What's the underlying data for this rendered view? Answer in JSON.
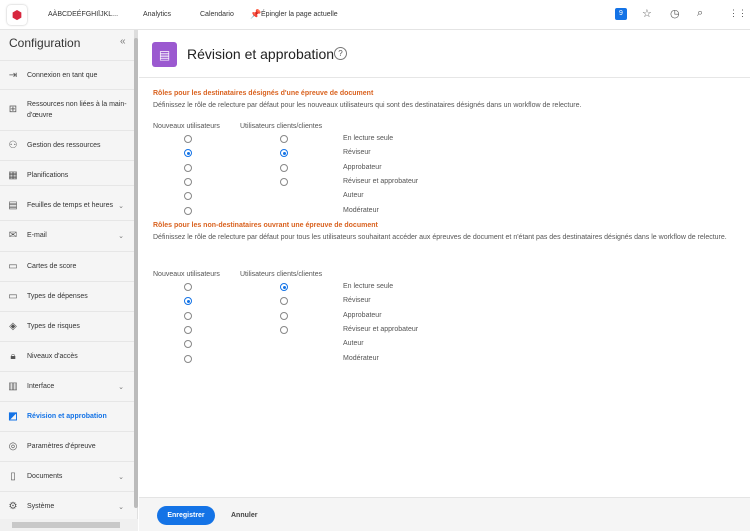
{
  "topbar": {
    "account": "AÀBCDEÉFGHIÏJKL...",
    "analytics": "Analytics",
    "calendar": "Calendario",
    "pin": "Épingler la page actuelle",
    "notif_count": "9"
  },
  "sidebar": {
    "title": "Configuration",
    "items": [
      {
        "label": "Connexion en tant que",
        "icon": "login-icon"
      },
      {
        "label": "Ressources non liées à la main-d'œuvre",
        "icon": "resources-icon"
      },
      {
        "label": "Gestion des ressources",
        "icon": "people-icon"
      },
      {
        "label": "Planifications",
        "icon": "calendar-icon"
      },
      {
        "label": "Feuilles de temps et heures",
        "icon": "timesheet-icon",
        "chevron": true
      },
      {
        "label": "E-mail",
        "icon": "email-icon",
        "chevron": true
      },
      {
        "label": "Cartes de score",
        "icon": "scorecard-icon"
      },
      {
        "label": "Types de dépenses",
        "icon": "expense-icon"
      },
      {
        "label": "Types de risques",
        "icon": "risk-icon"
      },
      {
        "label": "Niveaux d'accès",
        "icon": "lock-icon"
      },
      {
        "label": "Interface",
        "icon": "layout-icon",
        "chevron": true
      },
      {
        "label": "Révision et approbation",
        "icon": "review-icon",
        "active": true
      },
      {
        "label": "Paramètres d'épreuve",
        "icon": "proof-settings-icon"
      },
      {
        "label": "Documents",
        "icon": "document-icon",
        "chevron": true
      },
      {
        "label": "Système",
        "icon": "system-icon",
        "chevron": true
      }
    ]
  },
  "page": {
    "title": "Révision et approbation"
  },
  "columns": {
    "new_users": "Nouveaux utilisateurs",
    "clients": "Utilisateurs clients/clientes"
  },
  "roles": [
    "En lecture seule",
    "Réviseur",
    "Approbateur",
    "Réviseur et approbateur",
    "Auteur",
    "Modérateur"
  ],
  "section1": {
    "heading": "Rôles pour les destinataires désignés d'une épreuve de document",
    "description": "Définissez le rôle de relecture par défaut pour les nouveaux utilisateurs qui sont des destinataires désignés dans un workflow de relecture.",
    "new_users_selected": "Réviseur",
    "clients_selected": "Réviseur"
  },
  "section2": {
    "heading": "Rôles pour les non-destinataires ouvrant une épreuve de document",
    "description": "Définissez le rôle de relecture par défaut pour tous les utilisateurs souhaitant accéder aux épreuves de document et n'étant pas des destinataires désignés dans le workflow de relecture.",
    "new_users_selected": "Réviseur",
    "clients_selected": "En lecture seule"
  },
  "footer": {
    "save": "Enregistrer",
    "cancel": "Annuler"
  }
}
